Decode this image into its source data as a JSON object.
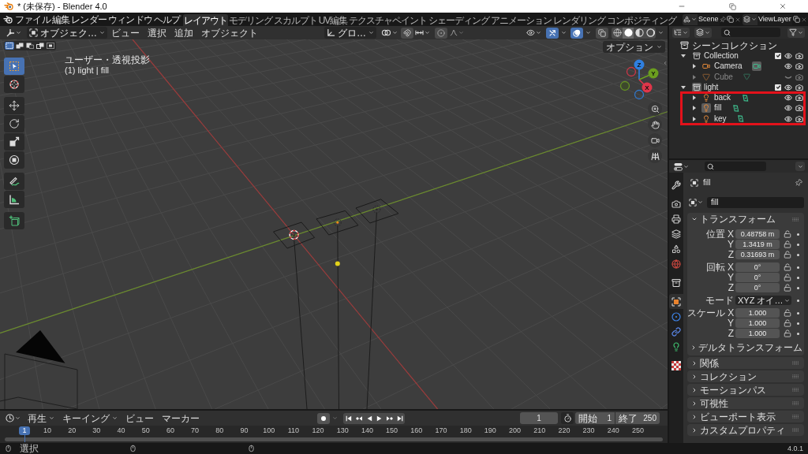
{
  "window": {
    "title": "* (未保存) - Blender 4.0"
  },
  "menu": [
    "ファイル",
    "編集",
    "レンダー",
    "ウィンドウ",
    "ヘルプ"
  ],
  "workspaces": [
    {
      "label": "レイアウト",
      "selected": true
    },
    {
      "label": "モデリング",
      "selected": false
    },
    {
      "label": "スカルプト",
      "selected": false
    },
    {
      "label": "UV編集",
      "selected": false
    },
    {
      "label": "テクスチャペイント",
      "selected": false
    },
    {
      "label": "シェーディング",
      "selected": false
    },
    {
      "label": "アニメーション",
      "selected": false
    },
    {
      "label": "レンダリング",
      "selected": false
    },
    {
      "label": "コンポジティング",
      "selected": false
    }
  ],
  "scene": {
    "value": "Scene"
  },
  "view_layer": {
    "value": "ViewLayer"
  },
  "viewport_header": {
    "mode": "オブジェク…",
    "menus": [
      "ビュー",
      "選択",
      "追加",
      "オブジェクト"
    ],
    "orientation": "グロ…",
    "snap": {
      "on": false
    },
    "proportional": {
      "on": false
    },
    "gizmos": {
      "on": true
    },
    "overlays": {
      "on": true
    },
    "xray": {
      "on": false
    },
    "shading": [
      {
        "kind": "wireframe",
        "selected": false
      },
      {
        "kind": "solid",
        "selected": true
      },
      {
        "kind": "material",
        "selected": false
      },
      {
        "kind": "rendered",
        "selected": false
      }
    ]
  },
  "viewport": {
    "select_modes": [
      {
        "kind": "set",
        "selected": true
      },
      {
        "kind": "extend",
        "selected": false
      },
      {
        "kind": "subtract",
        "selected": false
      },
      {
        "kind": "invert",
        "selected": false
      },
      {
        "kind": "intersect",
        "selected": false
      }
    ],
    "tool_groups": [
      [
        {
          "kind": "select_box",
          "selected": true
        },
        {
          "kind": "cursor",
          "selected": false
        }
      ],
      [
        {
          "kind": "move",
          "selected": false
        },
        {
          "kind": "rotate",
          "selected": false
        },
        {
          "kind": "scale",
          "selected": false
        },
        {
          "kind": "transform",
          "selected": false
        }
      ],
      [
        {
          "kind": "annotate",
          "selected": false
        },
        {
          "kind": "measure",
          "selected": false
        }
      ],
      [
        {
          "kind": "add_cube",
          "selected": false
        }
      ]
    ],
    "info": [
      "ユーザー・透視投影",
      "(1) light | fill"
    ],
    "options": "オプション",
    "gizmo_axes": [
      "Z",
      "Y",
      "X"
    ]
  },
  "outliner": {
    "root": "シーンコレクション",
    "collections": [
      {
        "label": "Collection",
        "expanded": true,
        "checked": true,
        "visible": true,
        "active": false,
        "highlighted": false,
        "children": [
          {
            "label": "Camera",
            "kind": "camera",
            "expanded": false,
            "visible": true,
            "active": false,
            "data_active": true
          },
          {
            "label": "Cube",
            "kind": "mesh",
            "expanded": false,
            "visible": false,
            "active": false,
            "data_active": false
          }
        ]
      },
      {
        "label": "light",
        "expanded": true,
        "checked": true,
        "visible": true,
        "active": true,
        "highlighted": true,
        "children": [
          {
            "label": "back",
            "kind": "light",
            "expanded": false,
            "visible": true,
            "active": false,
            "data_active": false
          },
          {
            "label": "fill",
            "kind": "light",
            "expanded": false,
            "visible": true,
            "active": true,
            "data_active": false
          },
          {
            "label": "key",
            "kind": "light",
            "expanded": false,
            "visible": true,
            "active": false,
            "data_active": false
          }
        ]
      }
    ]
  },
  "properties": {
    "tab_groups": [
      [
        {
          "kind": "tool",
          "selected": false
        }
      ],
      [
        {
          "kind": "render",
          "selected": false
        },
        {
          "kind": "output",
          "selected": false
        },
        {
          "kind": "view_layer",
          "selected": false
        },
        {
          "kind": "scene",
          "selected": false
        },
        {
          "kind": "world",
          "selected": false
        }
      ],
      [
        {
          "kind": "collection",
          "selected": false
        }
      ],
      [
        {
          "kind": "object",
          "selected": true
        },
        {
          "kind": "physics",
          "selected": false
        },
        {
          "kind": "constraints",
          "selected": false
        },
        {
          "kind": "light_data",
          "selected": false
        }
      ],
      [
        {
          "kind": "texture",
          "selected": false
        }
      ]
    ],
    "object_name": "fill",
    "data_name": "fill",
    "panels": [
      {
        "title": "トランスフォーム",
        "expanded": true,
        "groups": [
          [
            {
              "kind": "number",
              "label": "位置 X",
              "value": "0.48758 m"
            },
            {
              "kind": "number",
              "label": "Y",
              "value": "1.3419 m"
            },
            {
              "kind": "number",
              "label": "Z",
              "value": "0.31693 m"
            }
          ],
          [
            {
              "kind": "number",
              "label": "回転 X",
              "value": "0°"
            },
            {
              "kind": "number",
              "label": "Y",
              "value": "0°"
            },
            {
              "kind": "number",
              "label": "Z",
              "value": "0°"
            }
          ],
          [
            {
              "kind": "dropdown",
              "label": "モード",
              "value": "XYZ オイ…"
            }
          ],
          [
            {
              "kind": "number",
              "label": "スケール X",
              "value": "1.000"
            },
            {
              "kind": "number",
              "label": "Y",
              "value": "1.000"
            },
            {
              "kind": "number",
              "label": "Z",
              "value": "1.000"
            }
          ]
        ],
        "subpanels": [
          {
            "title": "デルタトランスフォーム",
            "expanded": false
          }
        ]
      },
      {
        "title": "関係",
        "expanded": false
      },
      {
        "title": "コレクション",
        "expanded": false
      },
      {
        "title": "モーションパス",
        "expanded": false
      },
      {
        "title": "可視性",
        "expanded": false
      },
      {
        "title": "ビューポート表示",
        "expanded": false
      },
      {
        "title": "カスタムプロパティ",
        "expanded": false
      }
    ]
  },
  "timeline": {
    "menus": [
      {
        "label": "再生",
        "dropdown": true
      },
      {
        "label": "キーイング",
        "dropdown": true
      },
      {
        "label": "ビュー",
        "dropdown": false
      },
      {
        "label": "マーカー",
        "dropdown": false
      }
    ],
    "auto_key": {
      "on": false
    },
    "current_frame": "1",
    "start": {
      "label": "開始",
      "value": "1"
    },
    "end": {
      "label": "終了",
      "value": "250"
    },
    "frames": [
      {
        "label": "1",
        "selected": true
      },
      {
        "label": "10",
        "selected": false
      },
      {
        "label": "20",
        "selected": false
      },
      {
        "label": "30",
        "selected": false
      },
      {
        "label": "40",
        "selected": false
      },
      {
        "label": "50",
        "selected": false
      },
      {
        "label": "60",
        "selected": false
      },
      {
        "label": "70",
        "selected": false
      },
      {
        "label": "80",
        "selected": false
      },
      {
        "label": "90",
        "selected": false
      },
      {
        "label": "100",
        "selected": false
      },
      {
        "label": "110",
        "selected": false
      },
      {
        "label": "120",
        "selected": false
      },
      {
        "label": "130",
        "selected": false
      },
      {
        "label": "140",
        "selected": false
      },
      {
        "label": "150",
        "selected": false
      },
      {
        "label": "160",
        "selected": false
      },
      {
        "label": "170",
        "selected": false
      },
      {
        "label": "180",
        "selected": false
      },
      {
        "label": "190",
        "selected": false
      },
      {
        "label": "200",
        "selected": false
      },
      {
        "label": "210",
        "selected": false
      },
      {
        "label": "220",
        "selected": false
      },
      {
        "label": "230",
        "selected": false
      },
      {
        "label": "240",
        "selected": false
      },
      {
        "label": "250",
        "selected": false
      }
    ]
  },
  "status_bar": {
    "hint": "選択",
    "version": "4.0.1"
  }
}
